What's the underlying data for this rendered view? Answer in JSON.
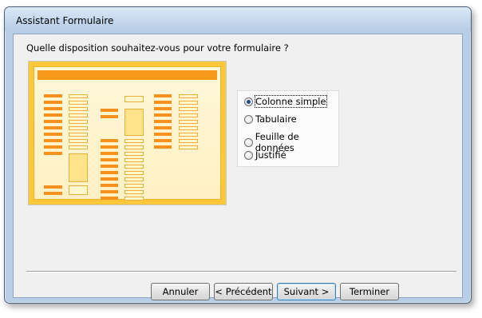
{
  "window": {
    "title": "Assistant Formulaire"
  },
  "question": "Quelle disposition souhaitez-vous pour votre formulaire ?",
  "layout_options": [
    {
      "label": "Colonne simple",
      "selected": true
    },
    {
      "label": "Tabulaire",
      "selected": false
    },
    {
      "label": "Feuille de données",
      "selected": false
    },
    {
      "label": "Justifié",
      "selected": false
    }
  ],
  "buttons": {
    "cancel": "Annuler",
    "previous": "< Précédent",
    "next": "Suivant >",
    "finish": "Terminer"
  },
  "colors": {
    "preview_frame": "#ffc83a",
    "preview_header": "#f79a1c",
    "accent": "#3c7fb1"
  }
}
